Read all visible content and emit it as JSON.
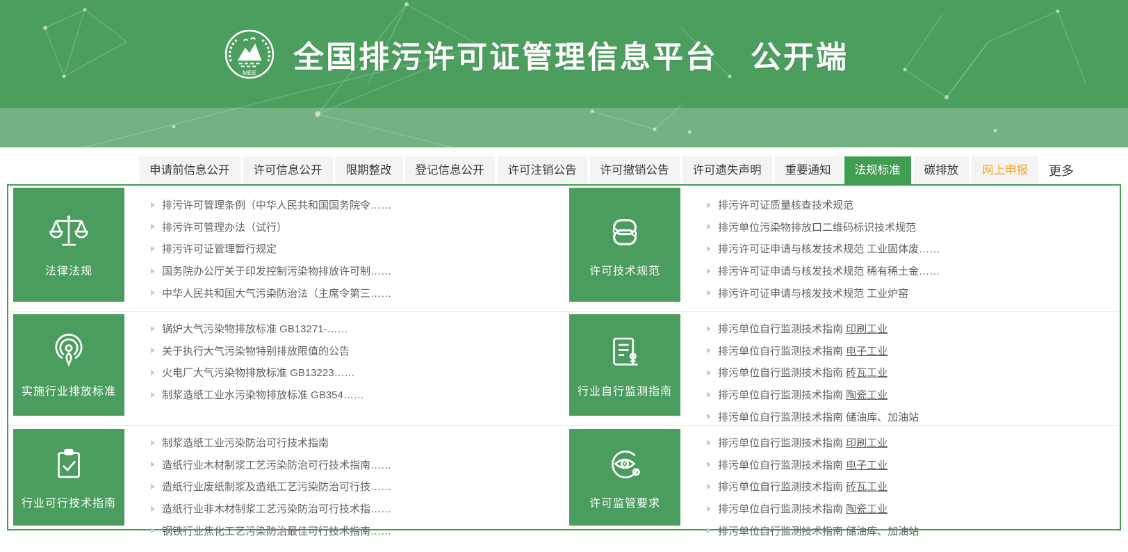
{
  "header": {
    "title": "全国排污许可证管理信息平台　公开端",
    "logo_text": "MEE"
  },
  "colors": {
    "header_green": "#4C9E5E",
    "band_green": "#74B381",
    "accent_green": "#3F9E51",
    "category_green": "#4A9D5E",
    "tab_bg": "#F4F4F4",
    "highlight_orange": "#F5A623",
    "list_text_gray": "#616161",
    "divider_gray": "#E2E2E2"
  },
  "tabs": [
    {
      "label": "申请前信息公开"
    },
    {
      "label": "许可信息公开"
    },
    {
      "label": "限期整改"
    },
    {
      "label": "登记信息公开"
    },
    {
      "label": "许可注销公告"
    },
    {
      "label": "许可撤销公告"
    },
    {
      "label": "许可遗失声明"
    },
    {
      "label": "重要通知"
    },
    {
      "label": "法规标准",
      "active": true
    },
    {
      "label": "碳排放"
    },
    {
      "label": "网上申报",
      "highlight": "orange"
    }
  ],
  "more_label": "更多",
  "sections": [
    {
      "title": "法律法规",
      "icon": "scales-icon",
      "items": [
        {
          "text": "排污许可管理条例（中华人民共和国国务院令……"
        },
        {
          "text": "排污许可管理办法（试行）"
        },
        {
          "text": "排污许可证管理暂行规定"
        },
        {
          "text": "国务院办公厅关于印发控制污染物排放许可制……"
        },
        {
          "text": "中华人民共和国大气污染防治法（主席令第三……"
        }
      ]
    },
    {
      "title": "许可技术规范",
      "icon": "tech-spec-link-icon",
      "items": [
        {
          "text": "排污许可证质量核查技术规范"
        },
        {
          "text": "排污单位污染物排放口二维码标识技术规范"
        },
        {
          "text": "排污许可证申请与核发技术规范 工业固体废……"
        },
        {
          "text": "排污许可证申请与核发技术规范 稀有稀土金……"
        },
        {
          "text": "排污许可证申请与核发技术规范 工业炉窑"
        }
      ]
    },
    {
      "title": "实施行业排放标准",
      "icon": "broadcast-icon",
      "items": [
        {
          "text": "锅炉大气污染物排放标准 GB13271-……"
        },
        {
          "text": "关于执行大气污染物特别排放限值的公告"
        },
        {
          "text": "火电厂大气污染物排放标准 GB13223……"
        },
        {
          "text": "制浆造纸工业水污染物排放标准 GB354……"
        }
      ]
    },
    {
      "title": "行业自行监测指南",
      "icon": "document-stamp-icon",
      "items": [
        {
          "text": "排污单位自行监测技术指南 ",
          "suffix": "印刷工业"
        },
        {
          "text": "排污单位自行监测技术指南 ",
          "suffix": "电子工业"
        },
        {
          "text": "排污单位自行监测技术指南 ",
          "suffix": "砖瓦工业"
        },
        {
          "text": "排污单位自行监测技术指南 ",
          "suffix": "陶瓷工业"
        },
        {
          "text": "排污单位自行监测技术指南 储油库、加油站"
        }
      ]
    },
    {
      "title": "行业可行技术指南",
      "icon": "clipboard-check-icon",
      "items": [
        {
          "text": "制浆造纸工业污染防治可行技术指南"
        },
        {
          "text": "造纸行业木材制浆工艺污染防治可行技术指南……"
        },
        {
          "text": "造纸行业废纸制浆及造纸工艺污染防治可行技……"
        },
        {
          "text": "造纸行业非木材制浆工艺污染防治可行技术指……"
        },
        {
          "text": "钢铁行业焦化工艺污染防治最佳可行技术指南……"
        }
      ]
    },
    {
      "title": "许可监管要求",
      "icon": "eye-monitor-icon",
      "items": [
        {
          "text": "排污单位自行监测技术指南 ",
          "suffix": "印刷工业"
        },
        {
          "text": "排污单位自行监测技术指南 ",
          "suffix": "电子工业"
        },
        {
          "text": "排污单位自行监测技术指南 ",
          "suffix": "砖瓦工业"
        },
        {
          "text": "排污单位自行监测技术指南 ",
          "suffix": "陶瓷工业"
        },
        {
          "text": "排污单位自行监测技术指南 储油库、加油站"
        }
      ]
    }
  ]
}
